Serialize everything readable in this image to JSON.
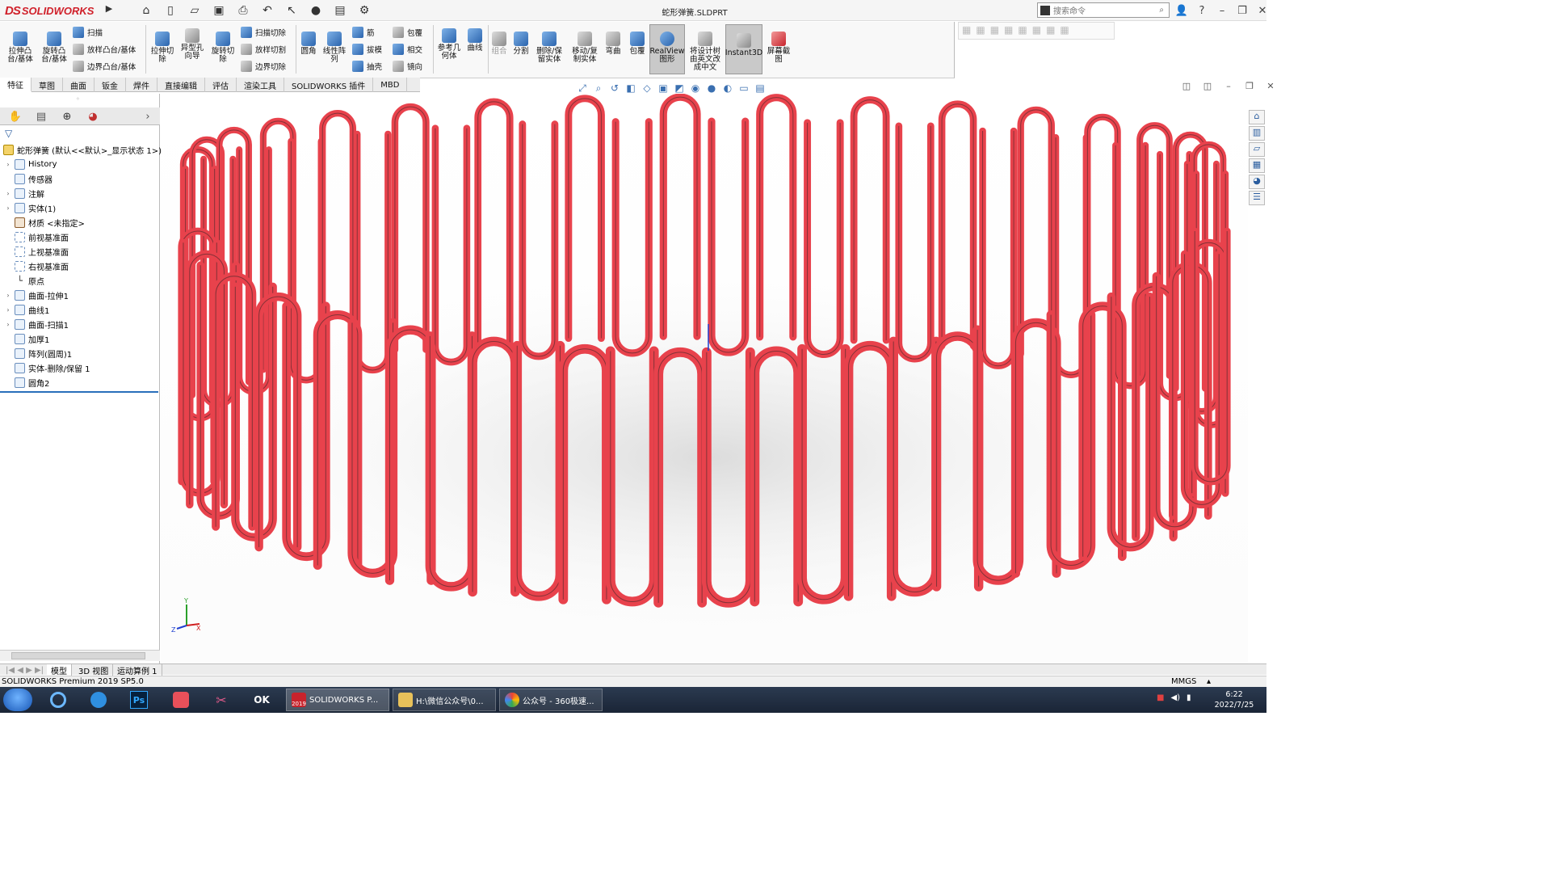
{
  "app": {
    "brand_ds": "DS",
    "brand_name": "SOLIDWORKS",
    "document_title": "蛇形弹簧.SLDPRT",
    "search_placeholder": "搜索命令"
  },
  "ribbon": {
    "large": [
      {
        "label": "拉伸凸台/基体",
        "icon": "extrude-boss-icon"
      },
      {
        "label": "旋转凸台/基体",
        "icon": "revolve-boss-icon"
      },
      {
        "label": "拉伸切除",
        "icon": "extrude-cut-icon"
      },
      {
        "label": "异型孔向导",
        "icon": "hole-wizard-icon"
      },
      {
        "label": "旋转切除",
        "icon": "revolve-cut-icon"
      },
      {
        "label": "圆角",
        "icon": "fillet-icon"
      },
      {
        "label": "线性阵列",
        "icon": "linear-pattern-icon"
      },
      {
        "label": "参考几何体",
        "icon": "reference-geometry-icon"
      },
      {
        "label": "曲线",
        "icon": "curves-icon"
      },
      {
        "label": "组合",
        "icon": "combine-icon"
      },
      {
        "label": "分割",
        "icon": "split-icon"
      },
      {
        "label": "删除/保留实体",
        "icon": "delete-keep-body-icon"
      },
      {
        "label": "移动/复制实体",
        "icon": "move-copy-body-icon"
      },
      {
        "label": "弯曲",
        "icon": "flex-icon"
      },
      {
        "label": "包覆",
        "icon": "wrap-icon"
      },
      {
        "label": "RealView图形",
        "icon": "realview-icon"
      },
      {
        "label": "将设计树由英文改成中文",
        "icon": "translate-tree-icon"
      },
      {
        "label": "Instant3D",
        "icon": "instant3d-icon"
      },
      {
        "label": "屏幕截图",
        "icon": "screen-capture-icon"
      }
    ],
    "small": [
      {
        "label": "扫描",
        "icon": "sweep-icon"
      },
      {
        "label": "放样凸台/基体",
        "icon": "loft-boss-icon"
      },
      {
        "label": "边界凸台/基体",
        "icon": "boundary-boss-icon"
      },
      {
        "label": "扫描切除",
        "icon": "swept-cut-icon"
      },
      {
        "label": "放样切割",
        "icon": "lofted-cut-icon"
      },
      {
        "label": "边界切除",
        "icon": "boundary-cut-icon"
      },
      {
        "label": "筋",
        "icon": "rib-icon"
      },
      {
        "label": "拔模",
        "icon": "draft-icon"
      },
      {
        "label": "抽壳",
        "icon": "shell-icon"
      },
      {
        "label": "包覆",
        "icon": "wrap-small-icon"
      },
      {
        "label": "相交",
        "icon": "intersect-icon"
      },
      {
        "label": "镜向",
        "icon": "mirror-icon"
      }
    ]
  },
  "tabs": [
    "特征",
    "草图",
    "曲面",
    "钣金",
    "焊件",
    "直接编辑",
    "评估",
    "渲染工具",
    "SOLIDWORKS 插件",
    "MBD"
  ],
  "tree": {
    "root": "蛇形弹簧 (默认<<默认>_显示状态 1>)",
    "items": [
      "History",
      "传感器",
      "注解",
      "实体(1)",
      "材质 <未指定>",
      "前视基准面",
      "上视基准面",
      "右视基准面",
      "原点",
      "曲面-拉伸1",
      "曲线1",
      "曲面-扫描1",
      "加厚1",
      "阵列(圆周)1",
      "实体-删除/保留 1",
      "圆角2"
    ]
  },
  "bottom_tabs": [
    "模型",
    "3D 视图",
    "运动算例 1"
  ],
  "status": {
    "product": "SOLIDWORKS Premium 2019 SP5.0",
    "units": "MMGS"
  },
  "taskbar": {
    "windows": [
      "SOLIDWORKS P...",
      "H:\\微信公众号\\0...",
      "公众号 - 360极速..."
    ],
    "sw_badge": "2019",
    "time": "6:22",
    "date": "2022/7/25",
    "ps": "Ps",
    "ok": "OK"
  },
  "triad": {
    "x": "X",
    "y": "Y",
    "z": "Z"
  },
  "colors": {
    "model": "#e8424c",
    "brand": "#d0202a",
    "taskbar": "#1f2b3d"
  }
}
